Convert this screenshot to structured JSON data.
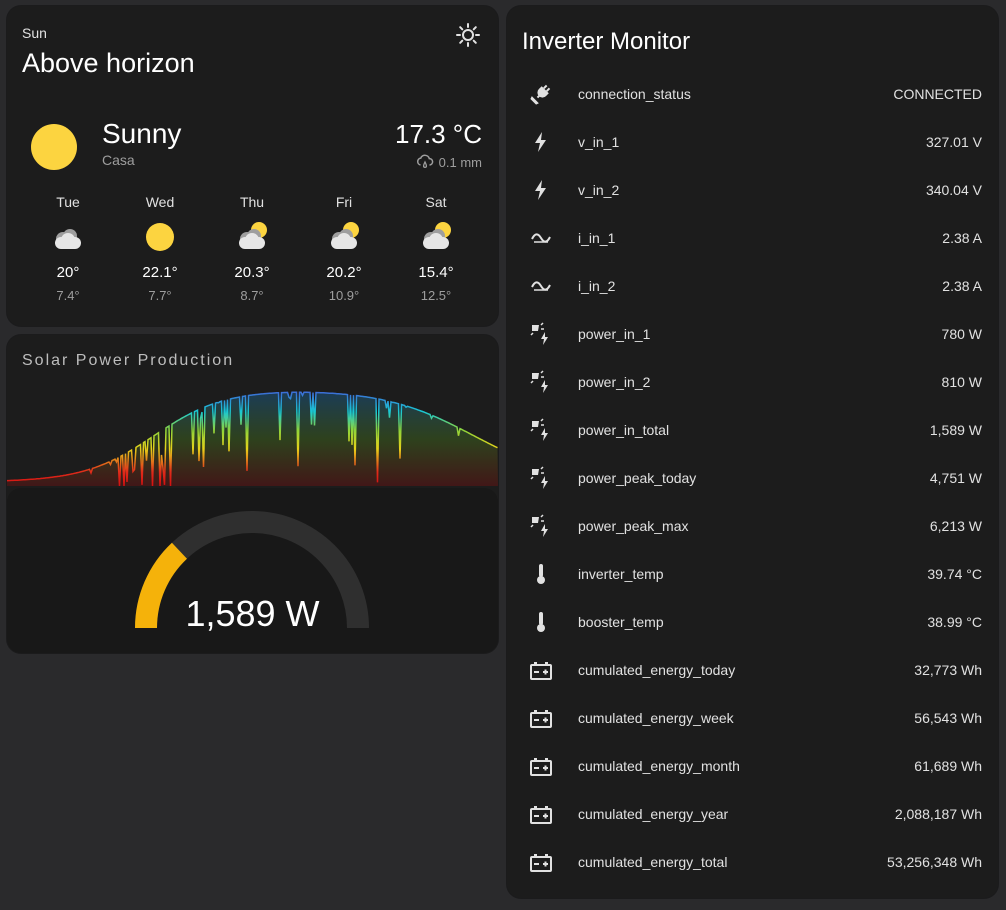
{
  "sun": {
    "label": "Sun",
    "state": "Above horizon"
  },
  "weather": {
    "condition": "Sunny",
    "location": "Casa",
    "temperature": "17.3 °C",
    "precipitation": "0.1 mm",
    "forecast": [
      {
        "day": "Tue",
        "high": "20°",
        "low": "7.4°",
        "icon": "cloudy-icon"
      },
      {
        "day": "Wed",
        "high": "22.1°",
        "low": "7.7°",
        "icon": "sunny-icon"
      },
      {
        "day": "Thu",
        "high": "20.3°",
        "low": "8.7°",
        "icon": "partly-cloudy-icon"
      },
      {
        "day": "Fri",
        "high": "20.2°",
        "low": "10.9°",
        "icon": "partly-cloudy-icon"
      },
      {
        "day": "Sat",
        "high": "15.4°",
        "low": "12.5°",
        "icon": "partly-cloudy-icon"
      }
    ]
  },
  "solar": {
    "title": "Solar Power Production",
    "gauge_value": "1,589 W",
    "gauge_fraction": 0.26
  },
  "inverter": {
    "title": "Inverter Monitor",
    "rows": [
      {
        "name": "connection_status",
        "value": "CONNECTED",
        "icon": "plug-icon"
      },
      {
        "name": "v_in_1",
        "value": "327.01 V",
        "icon": "flash-icon"
      },
      {
        "name": "v_in_2",
        "value": "340.04 V",
        "icon": "flash-icon"
      },
      {
        "name": "i_in_1",
        "value": "2.38 A",
        "icon": "current-ac-icon"
      },
      {
        "name": "i_in_2",
        "value": "2.38 A",
        "icon": "current-ac-icon"
      },
      {
        "name": "power_in_1",
        "value": "780 W",
        "icon": "solar-power-icon"
      },
      {
        "name": "power_in_2",
        "value": "810 W",
        "icon": "solar-power-icon"
      },
      {
        "name": "power_in_total",
        "value": "1,589 W",
        "icon": "solar-power-icon"
      },
      {
        "name": "power_peak_today",
        "value": "4,751 W",
        "icon": "solar-power-icon"
      },
      {
        "name": "power_peak_max",
        "value": "6,213 W",
        "icon": "solar-power-icon"
      },
      {
        "name": "inverter_temp",
        "value": "39.74 °C",
        "icon": "thermometer-icon"
      },
      {
        "name": "booster_temp",
        "value": "38.99 °C",
        "icon": "thermometer-icon"
      },
      {
        "name": "cumulated_energy_today",
        "value": "32,773 Wh",
        "icon": "battery-charging-icon"
      },
      {
        "name": "cumulated_energy_week",
        "value": "56,543 Wh",
        "icon": "battery-charging-icon"
      },
      {
        "name": "cumulated_energy_month",
        "value": "61,689 Wh",
        "icon": "battery-charging-icon"
      },
      {
        "name": "cumulated_energy_year",
        "value": "2,088,187 Wh",
        "icon": "battery-charging-icon"
      },
      {
        "name": "cumulated_energy_total",
        "value": "53,256,348 Wh",
        "icon": "battery-charging-icon"
      }
    ]
  },
  "colors": {
    "sun_yellow": "#fcd440",
    "gauge_fill": "#f5b20a",
    "gauge_track": "#2f2f2f"
  }
}
